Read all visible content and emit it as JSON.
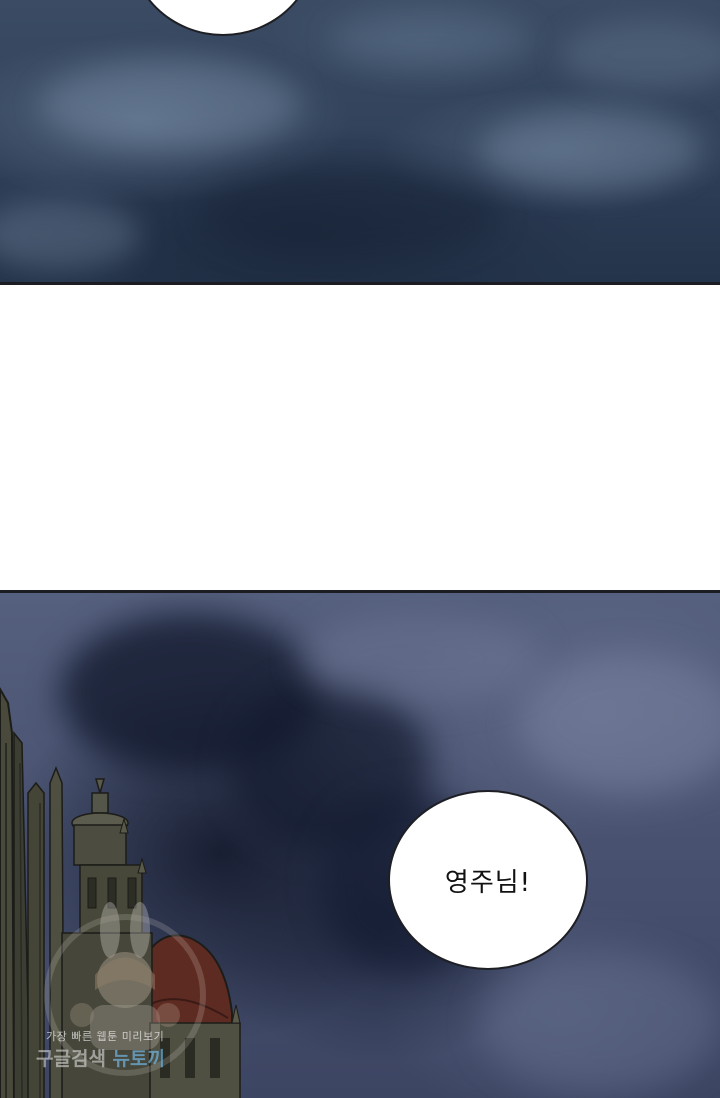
{
  "panels": {
    "bottom": {
      "speech_bubble": {
        "text": "영주님!"
      }
    }
  },
  "watermark": {
    "line1": "가장 빠른 웹툰 미리보기",
    "line2_main": "구글검색",
    "line2_accent": "뉴토끼"
  },
  "colors": {
    "panel_border": "#1b1d22",
    "sky_top": "#33445c",
    "storm": "#434c6a",
    "bubble_fill": "#ffffff"
  }
}
